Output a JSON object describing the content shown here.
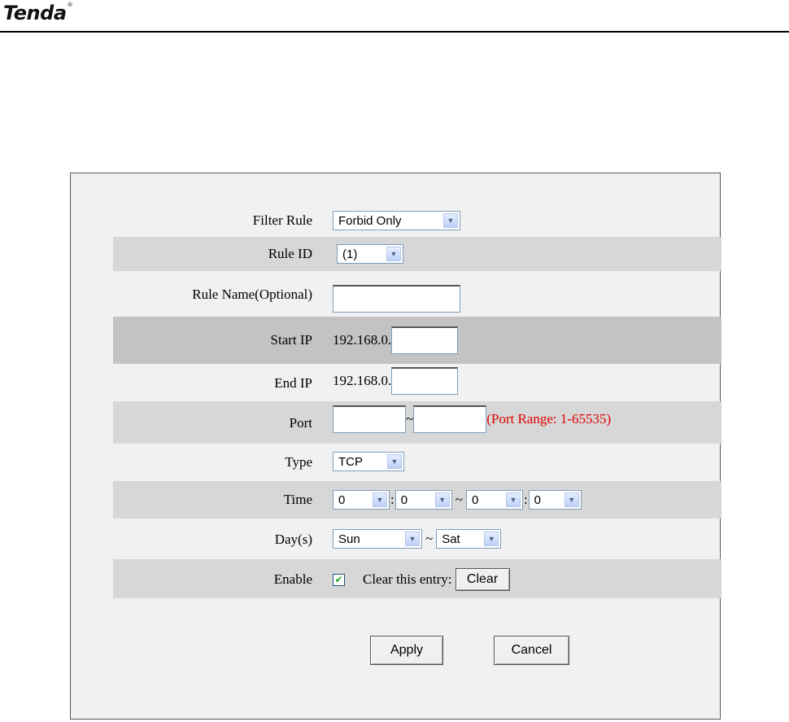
{
  "logo": {
    "text": "Tenda",
    "mark": "®"
  },
  "form": {
    "filter_rule": {
      "label": "Filter Rule",
      "value": "Forbid Only"
    },
    "rule_id": {
      "label": "Rule ID",
      "value": "(1)"
    },
    "rule_name": {
      "label": "Rule Name(Optional)",
      "value": ""
    },
    "start_ip": {
      "label": "Start IP",
      "prefix": "192.168.0.",
      "value": ""
    },
    "end_ip": {
      "label": "End IP",
      "prefix": "192.168.0.",
      "value": ""
    },
    "port": {
      "label": "Port",
      "start": "",
      "separator": "~",
      "end": "",
      "hint": "(Port Range: 1-65535)"
    },
    "type": {
      "label": "Type",
      "value": "TCP"
    },
    "time": {
      "label": "Time",
      "start_hour": "0",
      "colon": ":",
      "start_min": "0",
      "separator": "~",
      "end_hour": "0",
      "end_min": "0"
    },
    "days": {
      "label": "Day(s)",
      "start": "Sun",
      "separator": "~",
      "end": "Sat"
    },
    "enable": {
      "label": "Enable",
      "checked": true,
      "check_mark": "✔",
      "clear_label": "Clear this entry:",
      "clear_button": "Clear"
    }
  },
  "actions": {
    "apply": "Apply",
    "cancel": "Cancel"
  },
  "icons": {
    "dropdown": "chevron-down-icon",
    "check": "check-icon"
  },
  "colors": {
    "hint": "#e00000",
    "row_shade": "#d7d7d7",
    "row_dark": "#c3c3c3",
    "panel": "#f1f1f1"
  }
}
